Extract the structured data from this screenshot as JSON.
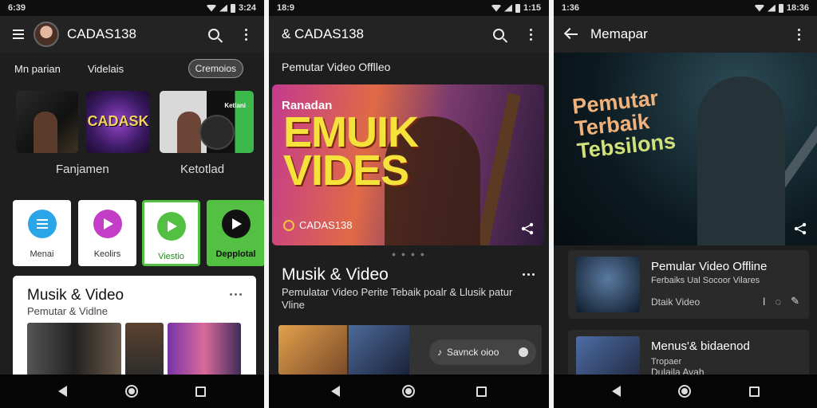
{
  "screen1": {
    "status_time": "6:39",
    "status_right": "3:24",
    "app_title": "CADAS138",
    "chips": [
      "Mn parian",
      "Videlais",
      "Cremoios"
    ],
    "thumb2_text": "CADASK",
    "thumb3_text": "Ketlani",
    "thumb_labels": [
      "Fanjamen",
      "Ketotlad"
    ],
    "tiles": [
      "Menai",
      "Keolirs",
      "Viestio",
      "Depplotal"
    ],
    "card_title": "Musik & Video",
    "card_subtitle": "Pemutar & Vidlne"
  },
  "screen2": {
    "status_time": "18:9",
    "status_right": "1:15",
    "app_title": "& CADAS138",
    "subtitle": "Pemutar Video Offlleo",
    "hero_small": "Ranadan",
    "hero_big_1": "EMUIK",
    "hero_big_2": "VIDES",
    "hero_badge": "CADAS138",
    "carousel_dots": "● ● ● ●",
    "section_title": "Musik & Video",
    "section_desc": "Pemulatar Video Perite Tebaik poalr & Llusik patur Vline",
    "pill_text": "Savnck oioo"
  },
  "screen3": {
    "status_time": "1:36",
    "status_right": "18:36",
    "app_title": "Memapar",
    "hero_line1": "Pemutar",
    "hero_line2": "Terbaik",
    "hero_line3": "Tebsilons",
    "rows": [
      {
        "title": "Pemular Video Offline",
        "subtitle": "Ferbaiks Ual Socoor Vilares",
        "meta": "Dtaik Video"
      },
      {
        "title": "Menus'& bidaenod",
        "subtitle": "Tropaer",
        "meta": "Dulaila Avah"
      }
    ]
  },
  "colors": {
    "background": "#1e1e1e",
    "appbar": "#232323",
    "green_accent": "#54c043",
    "blue_tile": "#2aa5e8",
    "magenta_tile": "#c33dc6",
    "hero_yellow": "#f5e33b"
  }
}
